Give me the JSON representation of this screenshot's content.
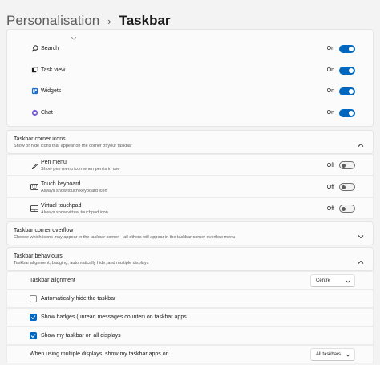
{
  "header": {
    "parent": "Personalisation",
    "separator": "›",
    "current": "Taskbar"
  },
  "taskbar_items": [
    {
      "label": "Search",
      "state": "On",
      "icon": "search-icon"
    },
    {
      "label": "Task view",
      "state": "On",
      "icon": "task-view-icon"
    },
    {
      "label": "Widgets",
      "state": "On",
      "icon": "widgets-icon"
    },
    {
      "label": "Chat",
      "state": "On",
      "icon": "chat-icon"
    }
  ],
  "corner_icons": {
    "title": "Taskbar corner icons",
    "subtitle": "Show or hide icons that appear on the corner of your taskbar",
    "items": [
      {
        "label": "Pen menu",
        "desc": "Show pen menu icon when pen is in use",
        "state": "Off",
        "icon": "pen-icon"
      },
      {
        "label": "Touch keyboard",
        "desc": "Always show touch keyboard icon",
        "state": "Off",
        "icon": "keyboard-icon"
      },
      {
        "label": "Virtual touchpad",
        "desc": "Always show virtual touchpad icon",
        "state": "Off",
        "icon": "touchpad-icon"
      }
    ]
  },
  "corner_overflow": {
    "title": "Taskbar corner overflow",
    "subtitle": "Choose which icons may appear in the taskbar corner – all others will appear in the taskbar corner overflow menu"
  },
  "behaviours": {
    "title": "Taskbar behaviours",
    "subtitle": "Taskbar alignment, badging, automatically hide, and multiple displays",
    "alignment_label": "Taskbar alignment",
    "alignment_value": "Centre",
    "auto_hide_label": "Automatically hide the taskbar",
    "badges_label": "Show badges (unread messages counter) on taskbar apps",
    "all_displays_label": "Show my taskbar on all displays",
    "multi_display_label": "When using multiple displays, show my taskbar apps on",
    "multi_display_value": "All taskbars"
  },
  "colors": {
    "accent": "#0067c0",
    "background": "#f3f3f3",
    "card": "#fbfbfb"
  }
}
